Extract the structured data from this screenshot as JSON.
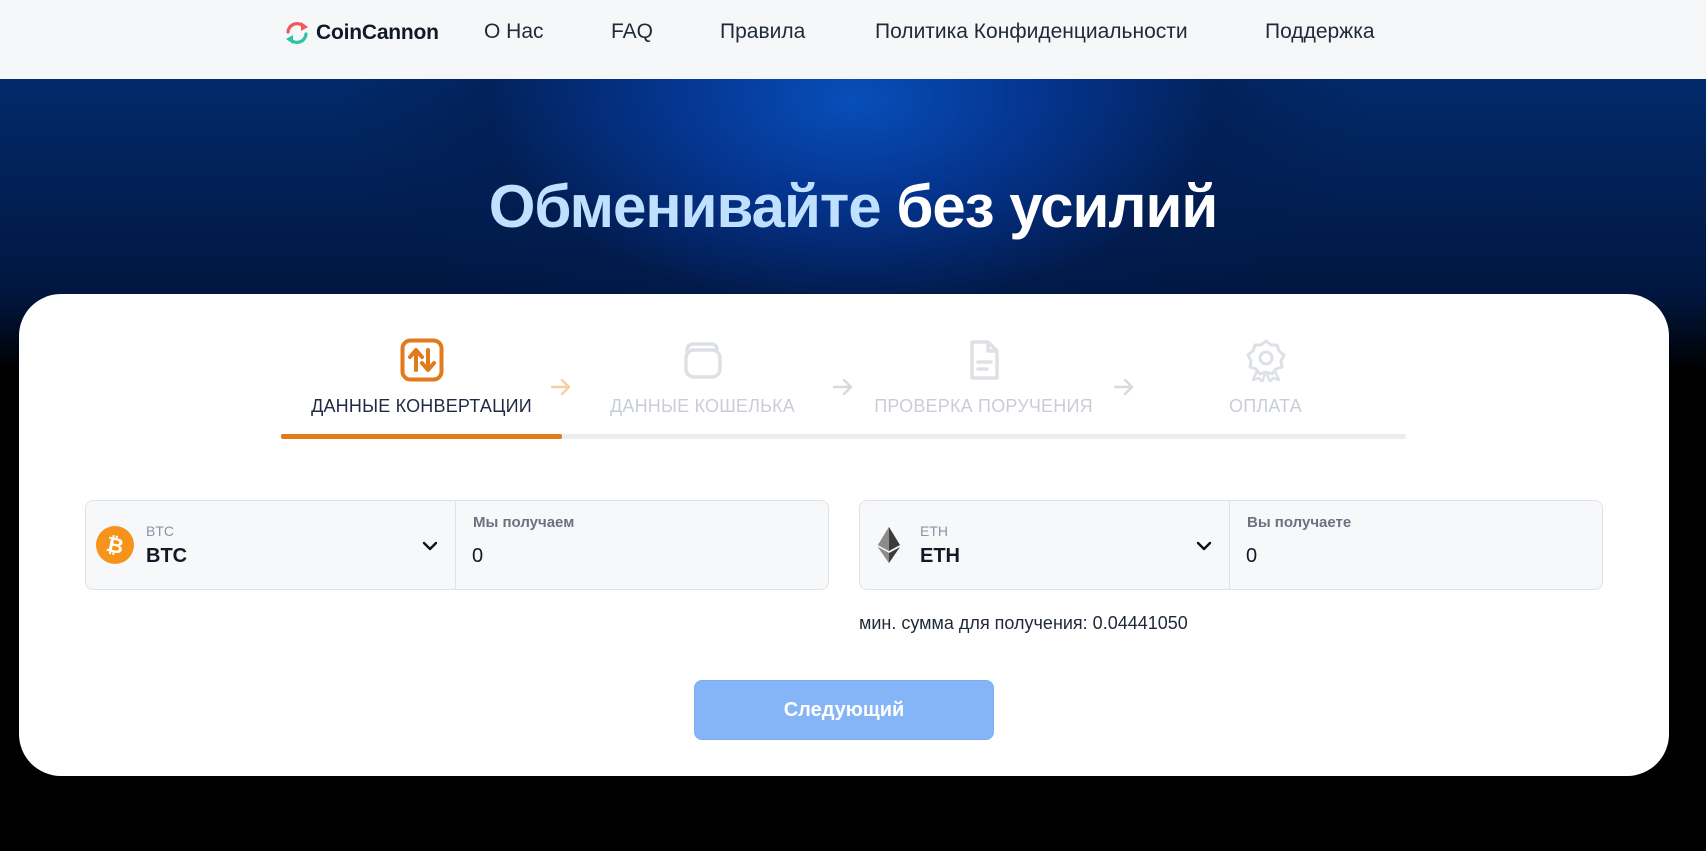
{
  "header": {
    "brand": "CoinCannon",
    "nav": [
      {
        "label": "О Нас"
      },
      {
        "label": "FAQ"
      },
      {
        "label": "Правила"
      },
      {
        "label": "Политика Конфиденциальности"
      },
      {
        "label": "Поддержка"
      }
    ]
  },
  "hero": {
    "title_accent": "Обменивайте",
    "title_rest": "без усилий"
  },
  "steps": [
    {
      "label": "ДАННЫЕ КОНВЕРТАЦИИ",
      "icon": "swap-arrows-icon",
      "state": "active"
    },
    {
      "label": "ДАННЫЕ КОШЕЛЬКА",
      "icon": "wallet-icon",
      "state": "inactive"
    },
    {
      "label": "ПРОВЕРКА ПОРУЧЕНИЯ",
      "icon": "document-icon",
      "state": "inactive"
    },
    {
      "label": "ОПЛАТА",
      "icon": "badge-icon",
      "state": "inactive"
    }
  ],
  "progress_fraction": 0.25,
  "send": {
    "ticker_small": "BTC",
    "ticker": "BTC",
    "amount_label": "Мы получаем",
    "amount_value": "0",
    "icon": "bitcoin-icon"
  },
  "receive": {
    "ticker_small": "ETH",
    "ticker": "ETH",
    "amount_label": "Вы получаете",
    "amount_value": "0",
    "icon": "ethereum-icon"
  },
  "min_note": "мин. сумма для получения: 0.04441050",
  "next_button": "Следующий",
  "colors": {
    "accent_orange": "#e27a1b",
    "button_blue": "#85b5f6",
    "hero_accent_text": "#bfe1ff"
  }
}
